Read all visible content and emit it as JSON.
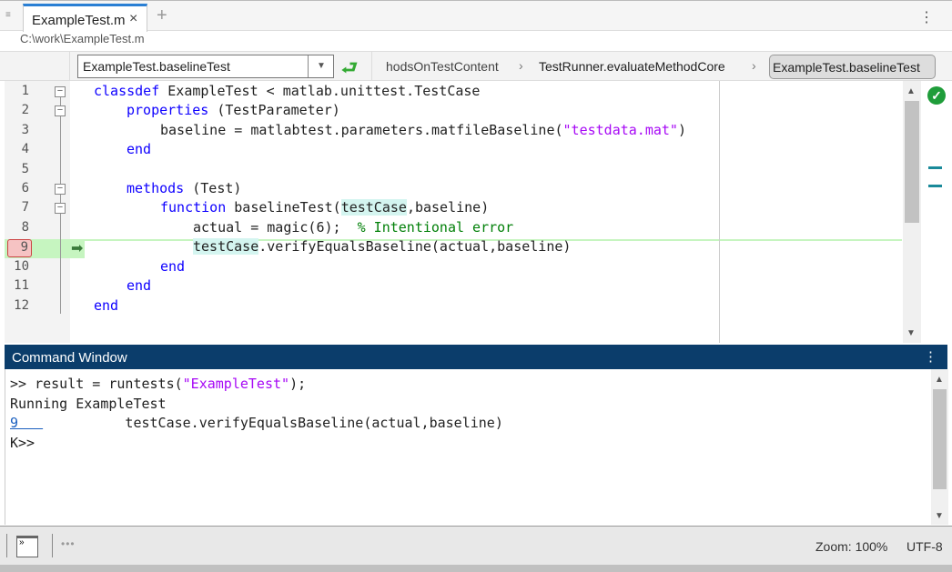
{
  "tabs": [
    {
      "label": "ExampleTest.m",
      "close": "×"
    }
  ],
  "new_tab": "+",
  "file_path": "C:\\work\\ExampleTest.m",
  "toolbar": {
    "function_select": "ExampleTest.baselineTest",
    "go_icon": "⮐",
    "breadcrumbs": [
      "hodsOnTestContent",
      "TestRunner.evaluateMethodCore",
      "ExampleTest.baselineTest"
    ]
  },
  "editor": {
    "line_numbers": [
      "1",
      "2",
      "3",
      "4",
      "5",
      "6",
      "7",
      "8",
      "9",
      "10",
      "11",
      "12"
    ],
    "current_line": "9",
    "code": {
      "l1a": "classdef",
      "l1b": " ExampleTest < matlab.unittest.TestCase",
      "l2a": "properties",
      "l2b": " (TestParameter)",
      "l3a": "baseline = matlabtest.parameters.matfileBaseline(",
      "l3b": "\"testdata.mat\"",
      "l3c": ")",
      "l4": "end",
      "l6a": "methods",
      "l6b": " (Test)",
      "l7a": "function",
      "l7b": " baselineTest(",
      "l7c": "testCase",
      "l7d": ",baseline)",
      "l8a": "actual = magic(6);  ",
      "l8b": "% Intentional error",
      "l9a": "testCase",
      "l9b": ".verifyEqualsBaseline(actual,baseline)",
      "l10": "end",
      "l11": "end",
      "l12": "end"
    }
  },
  "command_window": {
    "title": "Command Window",
    "lines": {
      "c1a": ">> result = runtests(",
      "c1b": "\"ExampleTest\"",
      "c1c": ");",
      "c2": "Running ExampleTest",
      "c3link": "9   ",
      "c3": "          testCase.verifyEqualsBaseline(actual,baseline)",
      "c4": "K>>"
    }
  },
  "status": {
    "zoom": "Zoom: 100%",
    "encoding": "UTF-8"
  }
}
